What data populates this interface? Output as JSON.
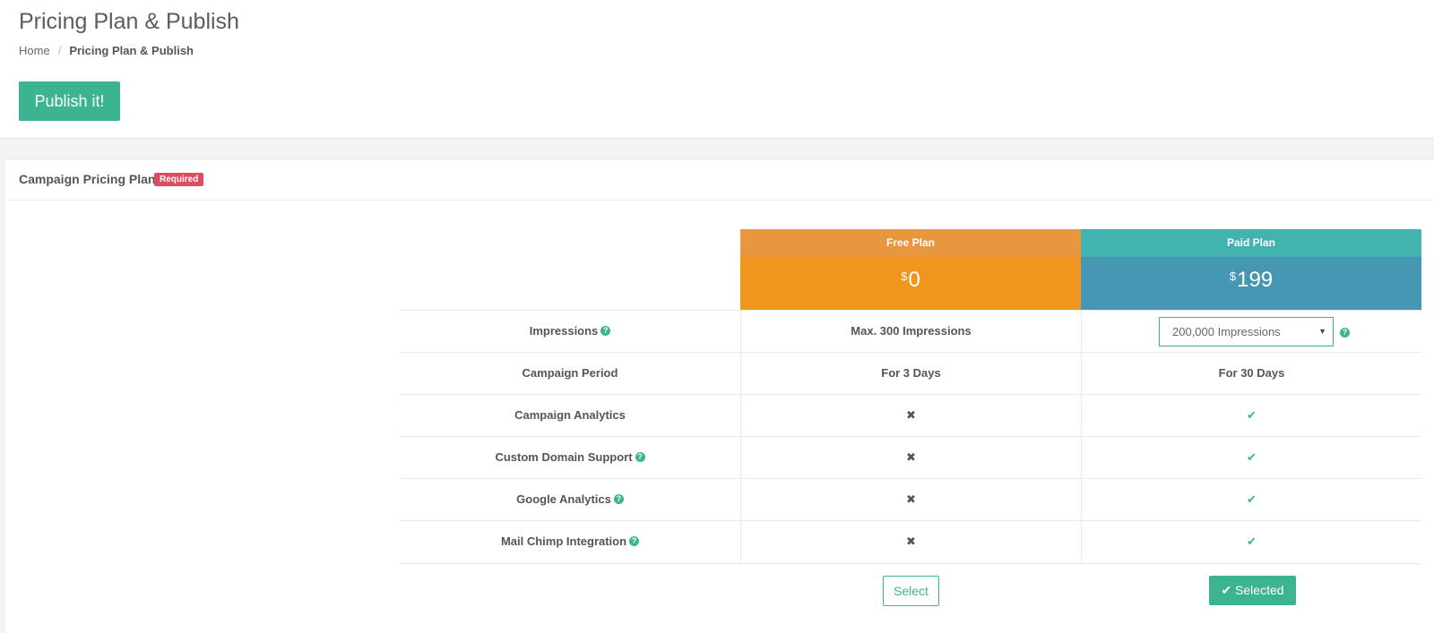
{
  "header": {
    "title": "Pricing Plan & Publish",
    "breadcrumb": {
      "home": "Home",
      "separator": "/",
      "current": "Pricing Plan & Publish"
    },
    "publish_label": "Publish it!"
  },
  "panel": {
    "title": "Campaign Pricing Plan",
    "badge": "Required"
  },
  "plans": [
    {
      "name": "Free Plan",
      "currency": "$",
      "price": "0",
      "header_color": "#e8973f",
      "price_color": "#f0961f"
    },
    {
      "name": "Paid Plan",
      "currency": "$",
      "price": "199",
      "header_color": "#43b3b0",
      "price_color": "#4697b4"
    }
  ],
  "features": [
    {
      "label": "Impressions",
      "help": "?",
      "free": "Max. 300 Impressions",
      "paid": ""
    },
    {
      "label": "Campaign Period",
      "help": "",
      "free": "For 3 Days",
      "paid": "For 30 Days"
    },
    {
      "label": "Campaign Analytics",
      "help": "",
      "free": "✖",
      "paid": "✔"
    },
    {
      "label": "Custom Domain Support",
      "help": "?",
      "free": "✖",
      "paid": "✔"
    },
    {
      "label": "Google Analytics",
      "help": "?",
      "free": "✖",
      "paid": "✔"
    },
    {
      "label": "Mail Chimp Integration",
      "help": "?",
      "free": "✖",
      "paid": "✔"
    }
  ],
  "impressions_select": {
    "value": "200,000 Impressions",
    "arrow": "▼",
    "help": "?"
  },
  "actions": {
    "select_label": "Select",
    "selected_label": "Selected",
    "selected_icon": "✔"
  },
  "colors": {
    "accent": "#3db491",
    "badge": "#e04b5d"
  }
}
